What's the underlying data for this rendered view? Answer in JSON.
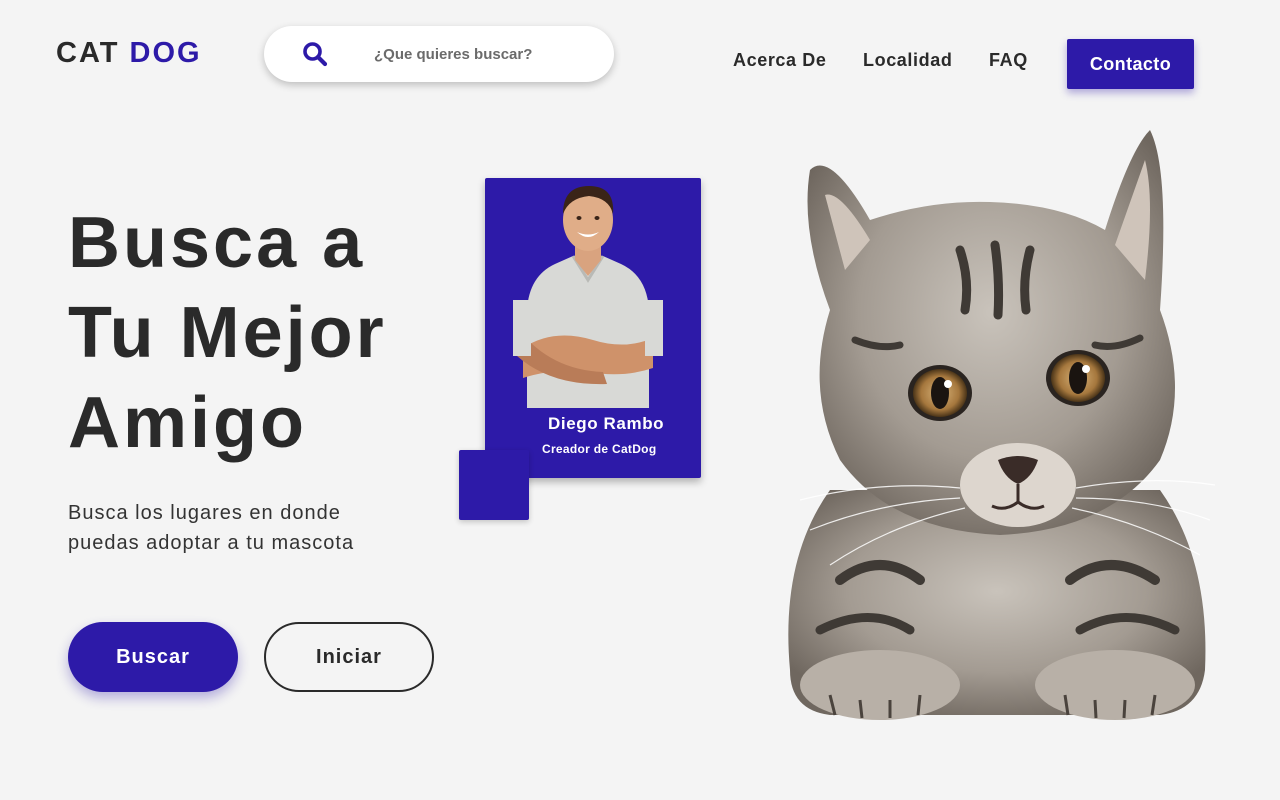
{
  "header": {
    "logo_part1": "CAT",
    "logo_part2": "DOG",
    "search": {
      "placeholder": "¿Que quieres buscar?",
      "icon": "search-icon"
    },
    "nav": {
      "about": "Acerca De",
      "location": "Localidad",
      "faq": "FAQ"
    },
    "contact_label": "Contacto"
  },
  "hero": {
    "title_line1": "Busca a",
    "title_line2": "Tu Mejor",
    "title_line3": "Amigo",
    "subtitle_line1": "Busca los lugares en donde",
    "subtitle_line2": "puedas adoptar a tu mascota",
    "primary_label": "Buscar",
    "secondary_label": "Iniciar"
  },
  "creator_card": {
    "name": "Diego Rambo",
    "role": "Creador de CatDog"
  },
  "colors": {
    "accent": "#2d1aa8",
    "background": "#f4f4f4",
    "text": "#2a2a2a"
  }
}
